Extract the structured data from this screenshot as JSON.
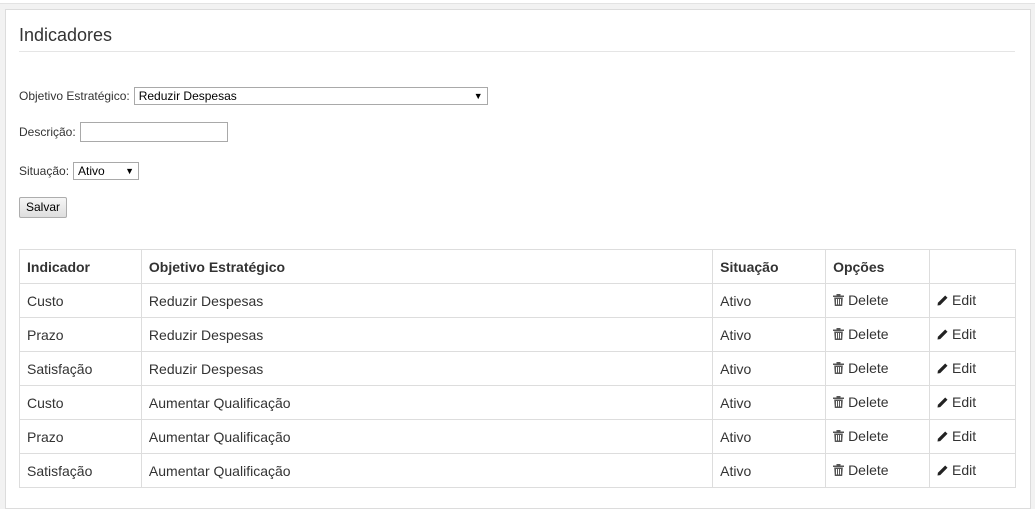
{
  "title": "Indicadores",
  "form": {
    "objetivo_label": "Objetivo Estratégico:",
    "objetivo_value": "Reduzir Despesas",
    "descricao_label": "Descrição:",
    "descricao_value": "",
    "situacao_label": "Situação:",
    "situacao_value": "Ativo",
    "save_label": "Salvar"
  },
  "table": {
    "headers": [
      "Indicador",
      "Objetivo Estratégico",
      "Situação",
      "Opções"
    ],
    "delete_label": "Delete",
    "edit_label": "Edit",
    "rows": [
      {
        "indicador": "Custo",
        "objetivo": "Reduzir Despesas",
        "situacao": "Ativo"
      },
      {
        "indicador": "Prazo",
        "objetivo": "Reduzir Despesas",
        "situacao": "Ativo"
      },
      {
        "indicador": "Satisfação",
        "objetivo": "Reduzir Despesas",
        "situacao": "Ativo"
      },
      {
        "indicador": "Custo",
        "objetivo": "Aumentar Qualificação",
        "situacao": "Ativo"
      },
      {
        "indicador": "Prazo",
        "objetivo": "Aumentar Qualificação",
        "situacao": "Ativo"
      },
      {
        "indicador": "Satisfação",
        "objetivo": "Aumentar Qualificação",
        "situacao": "Ativo"
      }
    ]
  }
}
